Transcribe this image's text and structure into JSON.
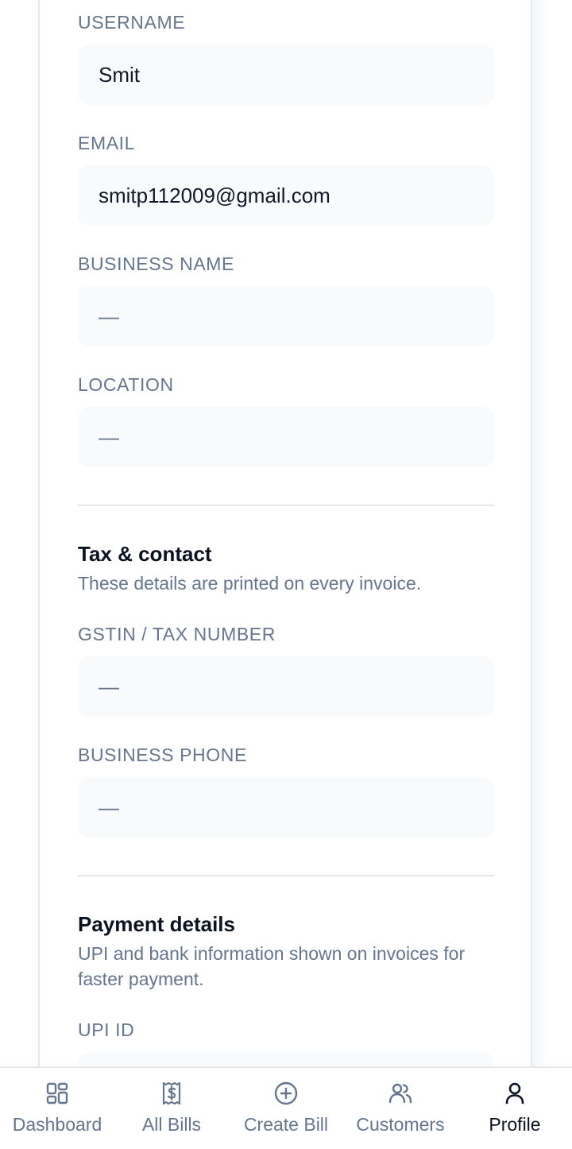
{
  "profile": {
    "fields": [
      {
        "label": "USERNAME",
        "value": "Smit"
      },
      {
        "label": "EMAIL",
        "value": "smitp112009@gmail.com"
      },
      {
        "label": "BUSINESS NAME",
        "value": "—"
      },
      {
        "label": "LOCATION",
        "value": "—"
      }
    ]
  },
  "tax_contact": {
    "title": "Tax & contact",
    "description": "These details are printed on every invoice.",
    "fields": [
      {
        "label": "GSTIN / TAX NUMBER",
        "value": "—"
      },
      {
        "label": "BUSINESS PHONE",
        "value": "—"
      }
    ]
  },
  "payment": {
    "title": "Payment details",
    "description": "UPI and bank information shown on invoices for faster payment.",
    "fields": [
      {
        "label": "UPI ID",
        "value": ""
      }
    ]
  },
  "bottom_nav": {
    "active": "Profile",
    "items": [
      {
        "label": "Dashboard",
        "icon": "dashboard-grid-icon"
      },
      {
        "label": "All Bills",
        "icon": "receipt-dollar-icon"
      },
      {
        "label": "Create Bill",
        "icon": "plus-circle-icon"
      },
      {
        "label": "Customers",
        "icon": "users-icon"
      },
      {
        "label": "Profile",
        "icon": "user-icon"
      }
    ]
  },
  "colors": {
    "label": "#66768c",
    "text": "#111827",
    "field_bg": "#f8fafc",
    "divider": "#e5e7eb",
    "active_nav": "#0b1220"
  }
}
